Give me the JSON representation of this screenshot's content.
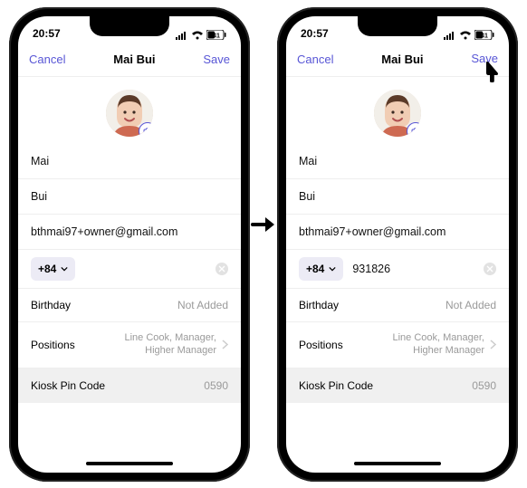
{
  "status": {
    "time": "20:57",
    "battery": "41"
  },
  "nav": {
    "cancel": "Cancel",
    "title": "Mai Bui",
    "save": "Save"
  },
  "contact": {
    "first_name": "Mai",
    "last_name": "Bui",
    "email": "bthmai97+owner@gmail.com",
    "dial_code": "+84",
    "phone_a": "",
    "phone_b": "931826"
  },
  "rows": {
    "birthday_label": "Birthday",
    "birthday_value": "Not Added",
    "positions_label": "Positions",
    "positions_value": "Line Cook, Manager, Higher Manager",
    "kiosk_label": "Kiosk Pin Code",
    "kiosk_value": "0590"
  }
}
